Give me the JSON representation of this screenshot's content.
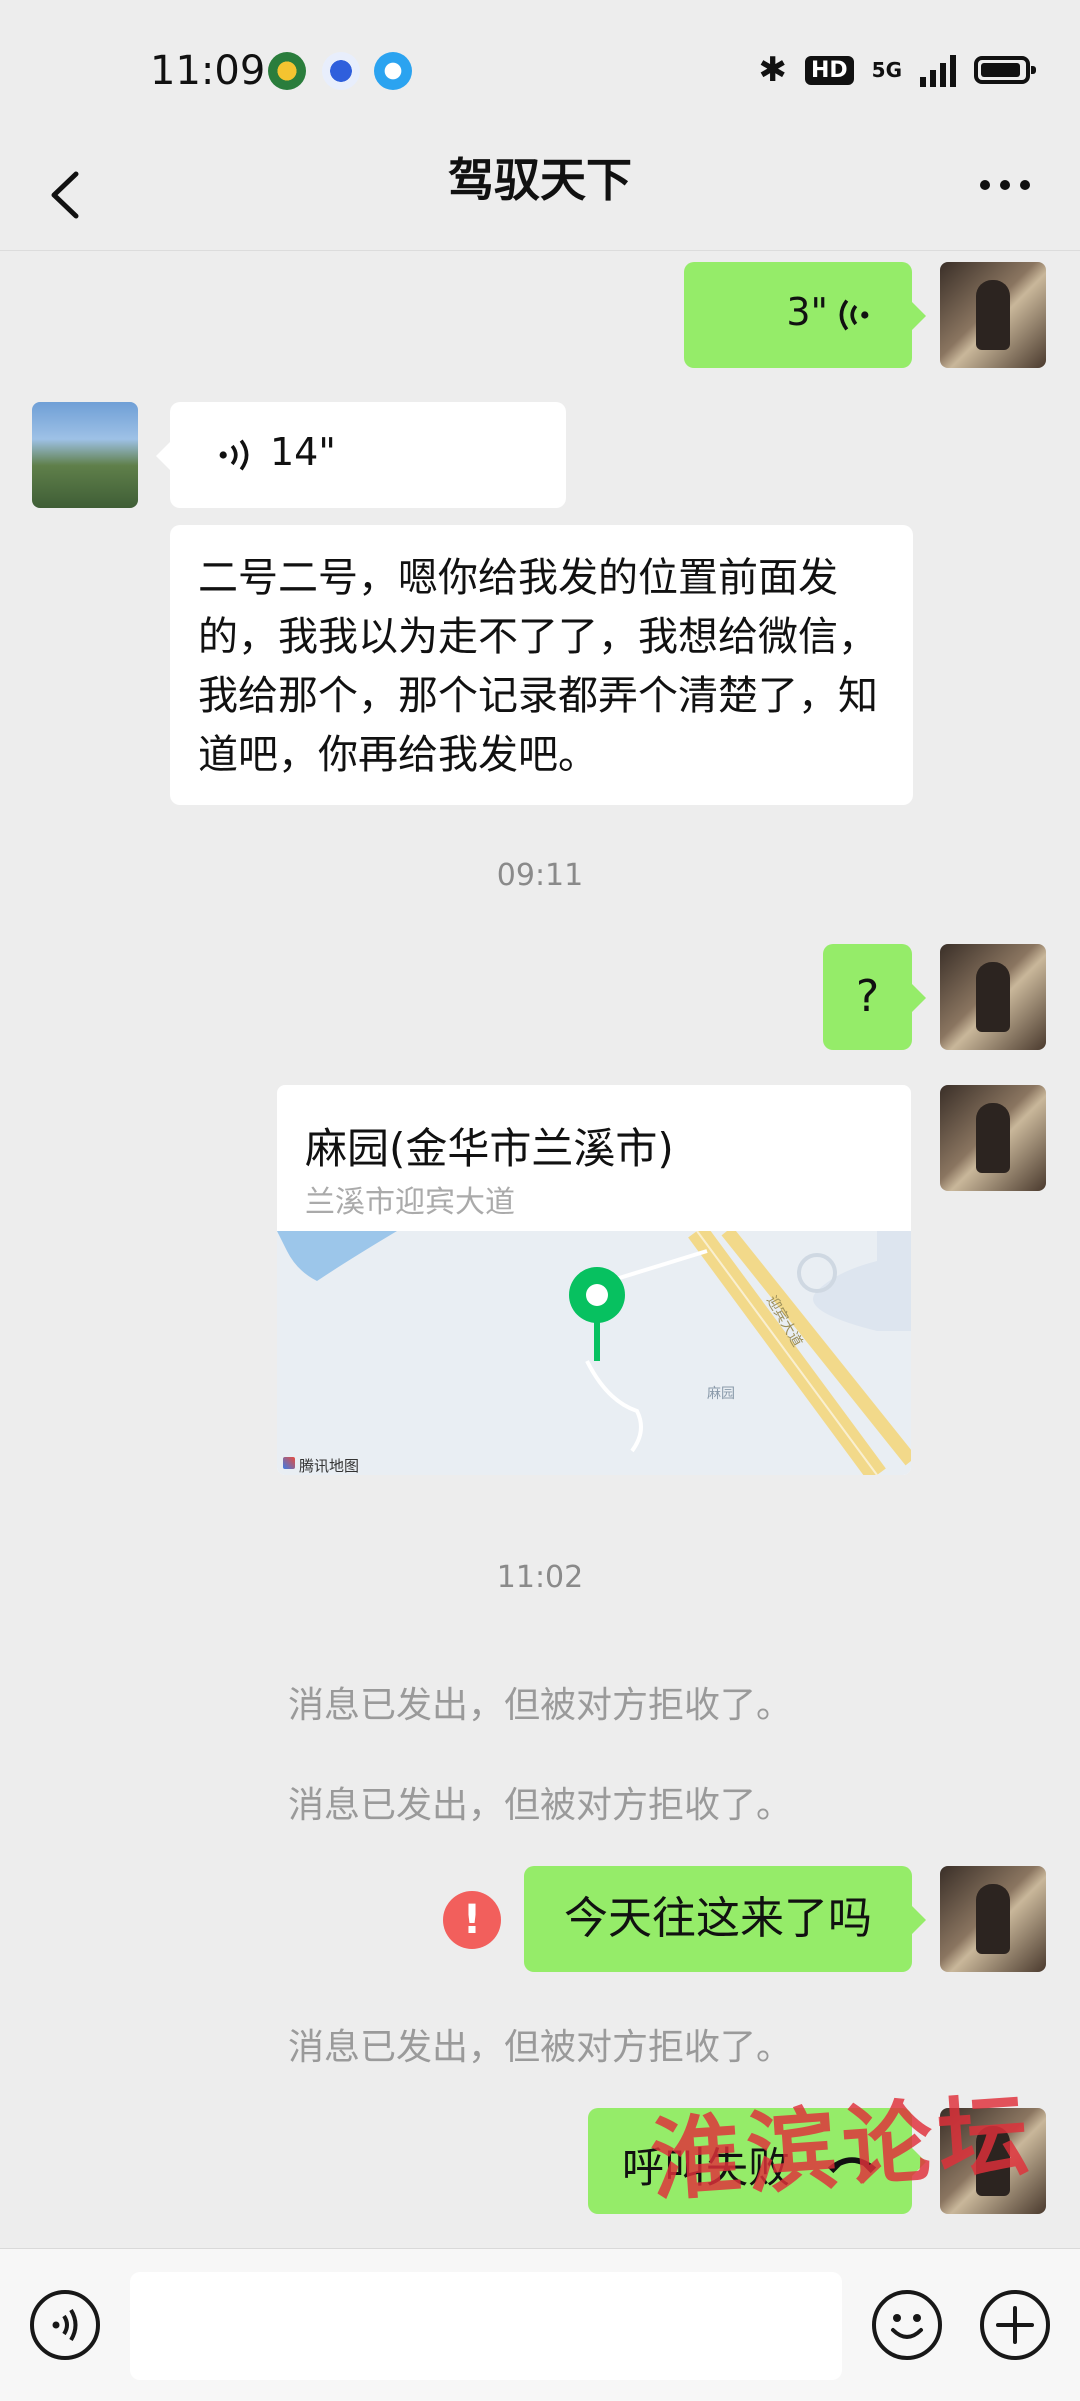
{
  "status_bar": {
    "time": "11:09",
    "network": "5G",
    "hd_badge": "HD"
  },
  "header": {
    "title": "驾驭天下"
  },
  "messages": {
    "voice_sent": {
      "duration": "3\""
    },
    "voice_received": {
      "duration": "14\""
    },
    "transcript": "二号二号，嗯你给我发的位置前面发的，我我以为走不了了，我想给微信，我给那个，那个记录都弄个清楚了，知道吧，你再给我发吧。",
    "time_1": "09:11",
    "question": "?",
    "location": {
      "name": "麻园(金华市兰溪市)",
      "address": "兰溪市迎宾大道",
      "map_brand": "腾讯地图",
      "road_label": "迎宾大道",
      "place_label": "麻园"
    },
    "time_2": "11:02",
    "rejected_1": "消息已发出，但被对方拒收了。",
    "rejected_2": "消息已发出，但被对方拒收了。",
    "failed_text": "今天往这来了吗",
    "rejected_3": "消息已发出，但被对方拒收了。",
    "call_failed": "呼叫失败"
  },
  "input": {
    "value": "",
    "placeholder": ""
  },
  "watermark": "淮滨论坛",
  "colors": {
    "background": "#ededed",
    "sent_bubble": "#95ec69",
    "received_bubble": "#ffffff",
    "error": "#f25f5c",
    "map_pin": "#07c160"
  }
}
